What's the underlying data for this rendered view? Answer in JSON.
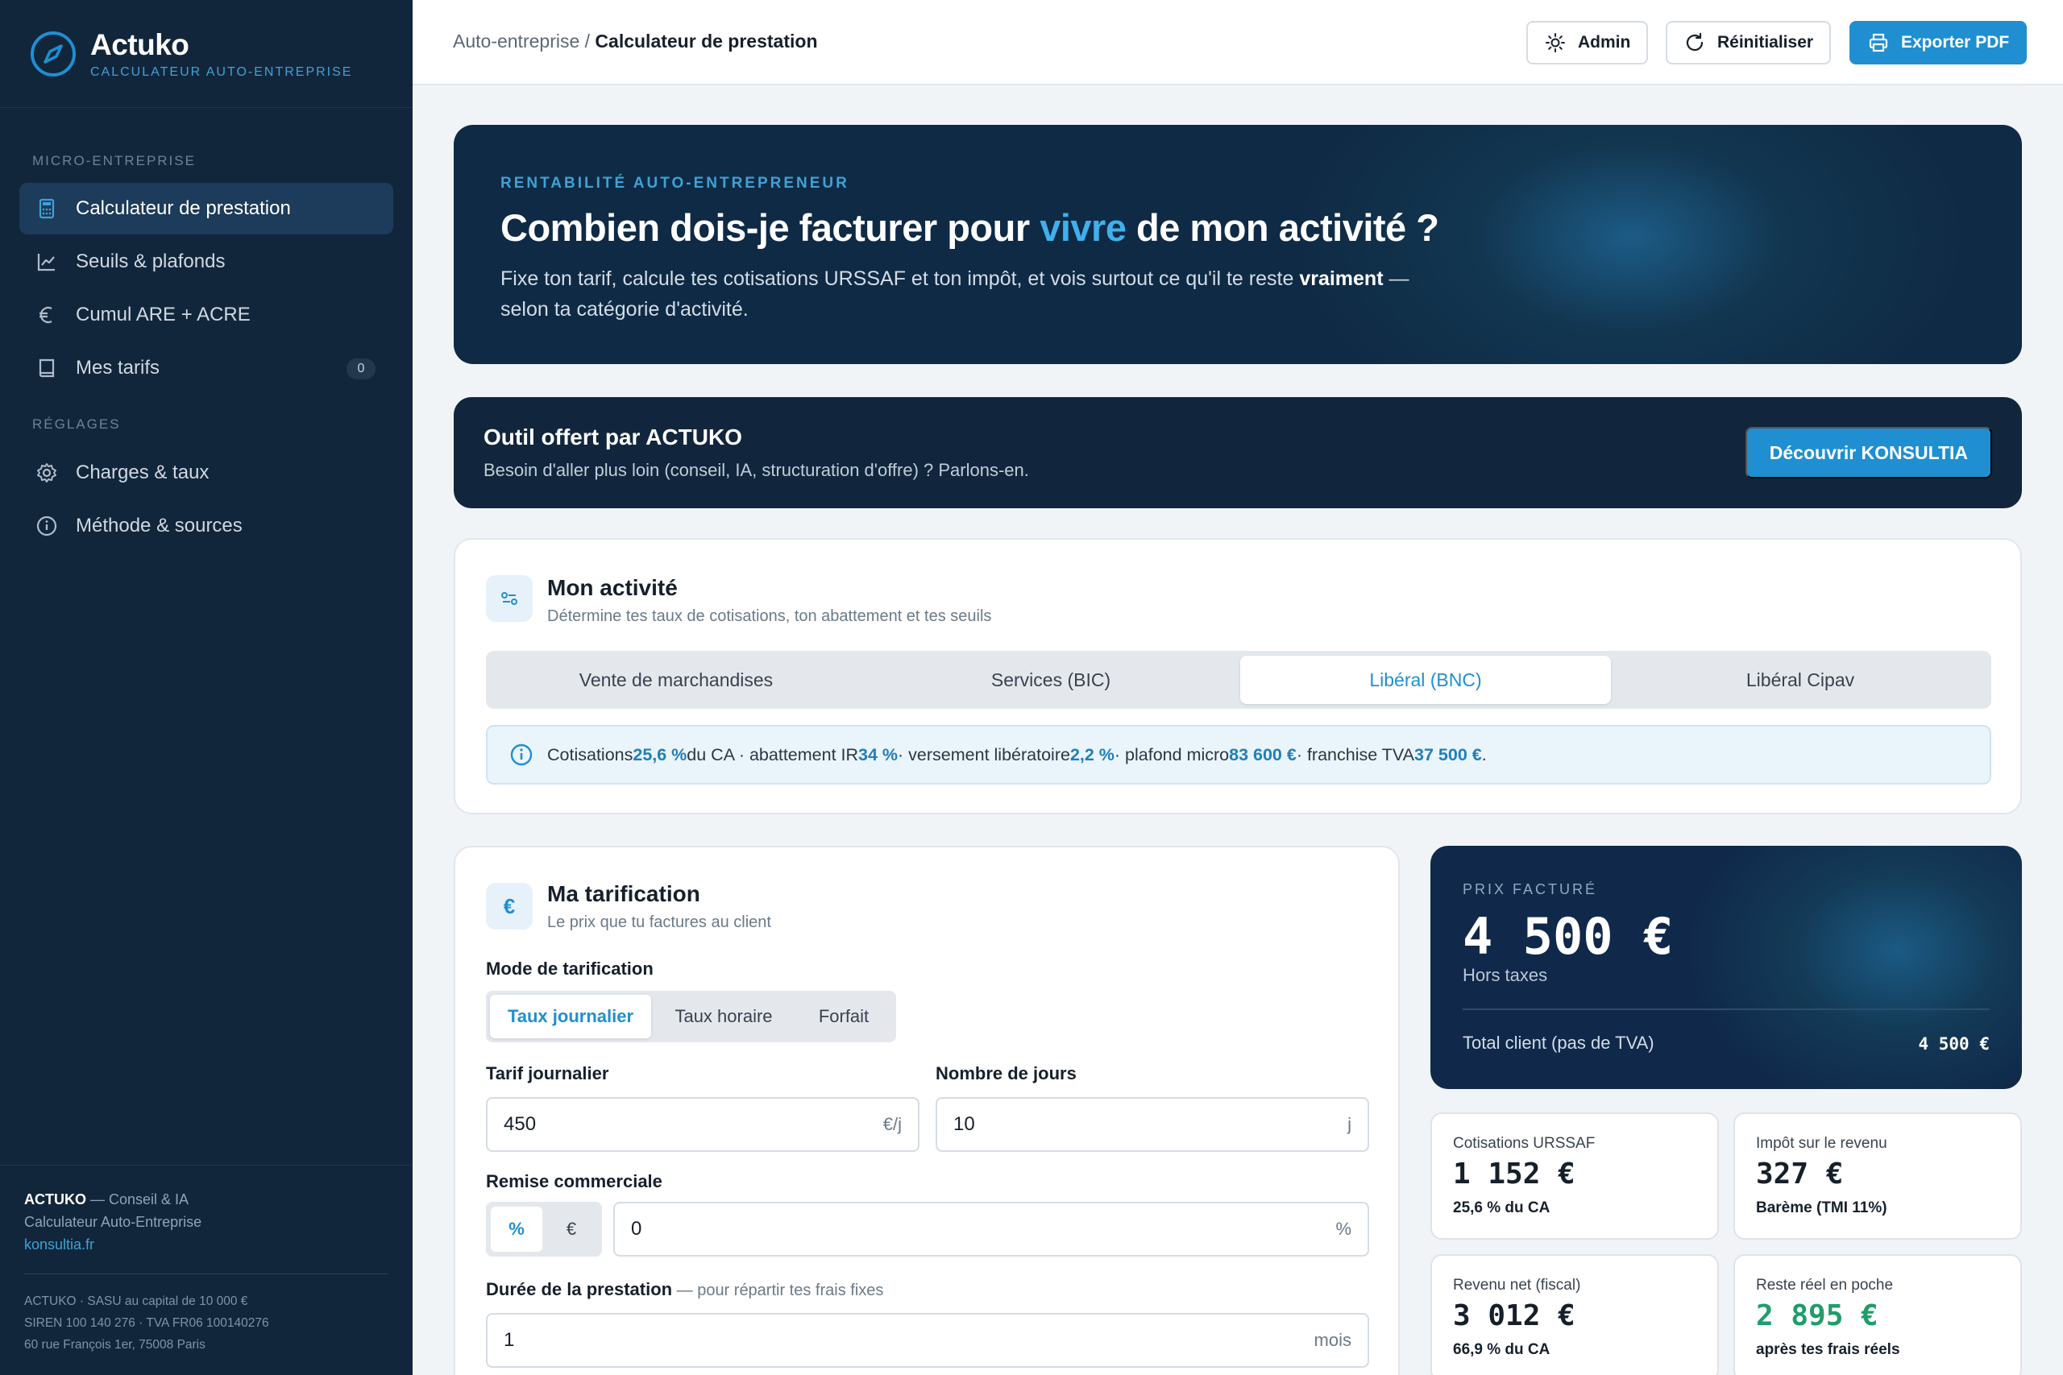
{
  "brand": {
    "name": "Actuko",
    "subtitle": "CALCULATEUR AUTO-ENTREPRISE"
  },
  "sidebar": {
    "section1": "MICRO-ENTREPRISE",
    "section2": "RÉGLAGES",
    "items": [
      {
        "label": "Calculateur de prestation",
        "icon": "calculator-icon",
        "active": true
      },
      {
        "label": "Seuils & plafonds",
        "icon": "chart-line-icon"
      },
      {
        "label": "Cumul ARE + ACRE",
        "icon": "euro-icon"
      },
      {
        "label": "Mes tarifs",
        "icon": "book-icon",
        "badge": "0"
      },
      {
        "label": "Charges & taux",
        "icon": "gear-icon"
      },
      {
        "label": "Méthode & sources",
        "icon": "info-icon"
      }
    ],
    "footer": {
      "company": "ACTUKO",
      "tagline": " — Conseil & IA",
      "line2": "Calculateur Auto-Entreprise",
      "link": "konsultia.fr",
      "legal1": "ACTUKO · SASU au capital de 10 000 €",
      "legal2": "SIREN 100 140 276 · TVA FR06 100140276",
      "legal3": "60 rue François 1er, 75008 Paris"
    }
  },
  "topbar": {
    "crumb_parent": "Auto-entreprise",
    "crumb_sep": " / ",
    "crumb_current": "Calculateur de prestation",
    "admin_label": "Admin",
    "reset_label": "Réinitialiser",
    "export_label": "Exporter PDF"
  },
  "hero": {
    "eyebrow": "RENTABILITÉ AUTO-ENTREPRENEUR",
    "title_before": "Combien dois-je facturer pour ",
    "title_highlight": "vivre",
    "title_after": " de mon activité ?",
    "desc_before": "Fixe ton tarif, calcule tes cotisations URSSAF et ton impôt, et vois surtout ce qu'il te reste ",
    "desc_bold": "vraiment",
    "desc_after": " — selon ta catégorie d'activité."
  },
  "promo": {
    "title": "Outil offert par ACTUKO",
    "subtitle": "Besoin d'aller plus loin (conseil, IA, structuration d'offre) ? Parlons-en.",
    "button": "Découvrir KONSULTIA"
  },
  "activity": {
    "title": "Mon activité",
    "subtitle": "Détermine tes taux de cotisations, ton abattement et tes seuils",
    "options": [
      "Vente de marchandises",
      "Services (BIC)",
      "Libéral (BNC)",
      "Libéral Cipav"
    ],
    "selected_index": 2,
    "info": {
      "t1": "Cotisations ",
      "v1": "25,6 %",
      "t2": " du CA · abattement IR ",
      "v2": "34 %",
      "t3": " · versement libératoire ",
      "v3": "2,2 %",
      "t4": " · plafond micro ",
      "v4": "83 600 €",
      "t5": " · franchise TVA ",
      "v5": "37 500 €",
      "t6": "."
    }
  },
  "pricing": {
    "title": "Ma tarification",
    "subtitle": "Le prix que tu factures au client",
    "icon_symbol": "€",
    "mode_label": "Mode de tarification",
    "modes": [
      "Taux journalier",
      "Taux horaire",
      "Forfait"
    ],
    "daily_rate_label": "Tarif journalier",
    "daily_rate_value": "450",
    "daily_rate_unit": "€/j",
    "days_label": "Nombre de jours",
    "days_value": "10",
    "days_unit": "j",
    "discount_label": "Remise commerciale",
    "discount_modes": [
      "%",
      "€"
    ],
    "discount_value": "0",
    "discount_unit": "%",
    "duration_label": "Durée de la prestation",
    "duration_hint": " — pour répartir tes frais fixes",
    "duration_value": "1",
    "duration_unit": "mois"
  },
  "result": {
    "eyebrow": "PRIX FACTURÉ",
    "price": "4 500 €",
    "price_sub": "Hors taxes",
    "total_label": "Total client (pas de TVA)",
    "total_value": "4 500 €"
  },
  "stats": [
    {
      "label": "Cotisations URSSAF",
      "value": "1 152 €",
      "sub": "25,6 % du CA"
    },
    {
      "label": "Impôt sur le revenu",
      "value": "327 €",
      "sub": "Barème (TMI 11%)"
    },
    {
      "label": "Revenu net (fiscal)",
      "value": "3 012 €",
      "sub": "66,9 % du CA"
    },
    {
      "label": "Reste réel en poche",
      "value": "2 895 €",
      "sub": "après tes frais réels"
    }
  ],
  "colors": {
    "accent": "#1f8fd1",
    "sidebar": "#12263b",
    "positive": "#1f9d6a"
  }
}
